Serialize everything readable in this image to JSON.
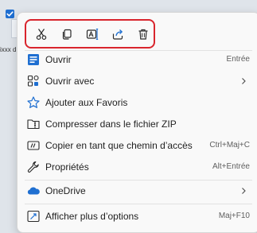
{
  "desktop": {
    "file_label": "ixxx d"
  },
  "toolbar": {
    "buttons": [
      {
        "name": "cut",
        "icon": "scissors-icon"
      },
      {
        "name": "copy",
        "icon": "copy-icon"
      },
      {
        "name": "rename",
        "icon": "rename-icon"
      },
      {
        "name": "share",
        "icon": "share-icon"
      },
      {
        "name": "delete",
        "icon": "trash-icon"
      }
    ],
    "highlight_color": "#d9252d"
  },
  "menu": {
    "items": [
      {
        "label": "Ouvrir",
        "shortcut": "Entrée",
        "icon": "open-app-icon"
      },
      {
        "label": "Ouvrir avec",
        "shortcut": "",
        "icon": "open-with-icon",
        "submenu": true
      },
      {
        "label": "Ajouter aux Favoris",
        "shortcut": "",
        "icon": "star-icon"
      },
      {
        "label": "Compresser dans le fichier ZIP",
        "shortcut": "",
        "icon": "zip-folder-icon"
      },
      {
        "label": "Copier en tant que chemin d’accès",
        "shortcut": "Ctrl+Maj+C",
        "icon": "copy-path-icon"
      },
      {
        "label": "Propriétés",
        "shortcut": "Alt+Entrée",
        "icon": "wrench-icon"
      },
      {
        "label": "OneDrive",
        "shortcut": "",
        "icon": "onedrive-cloud-icon",
        "submenu": true
      },
      {
        "label": "Afficher plus d’options",
        "shortcut": "Maj+F10",
        "icon": "more-options-icon"
      }
    ]
  },
  "colors": {
    "accent": "#1f6fd1",
    "menu_background": "#f9f9f9"
  }
}
